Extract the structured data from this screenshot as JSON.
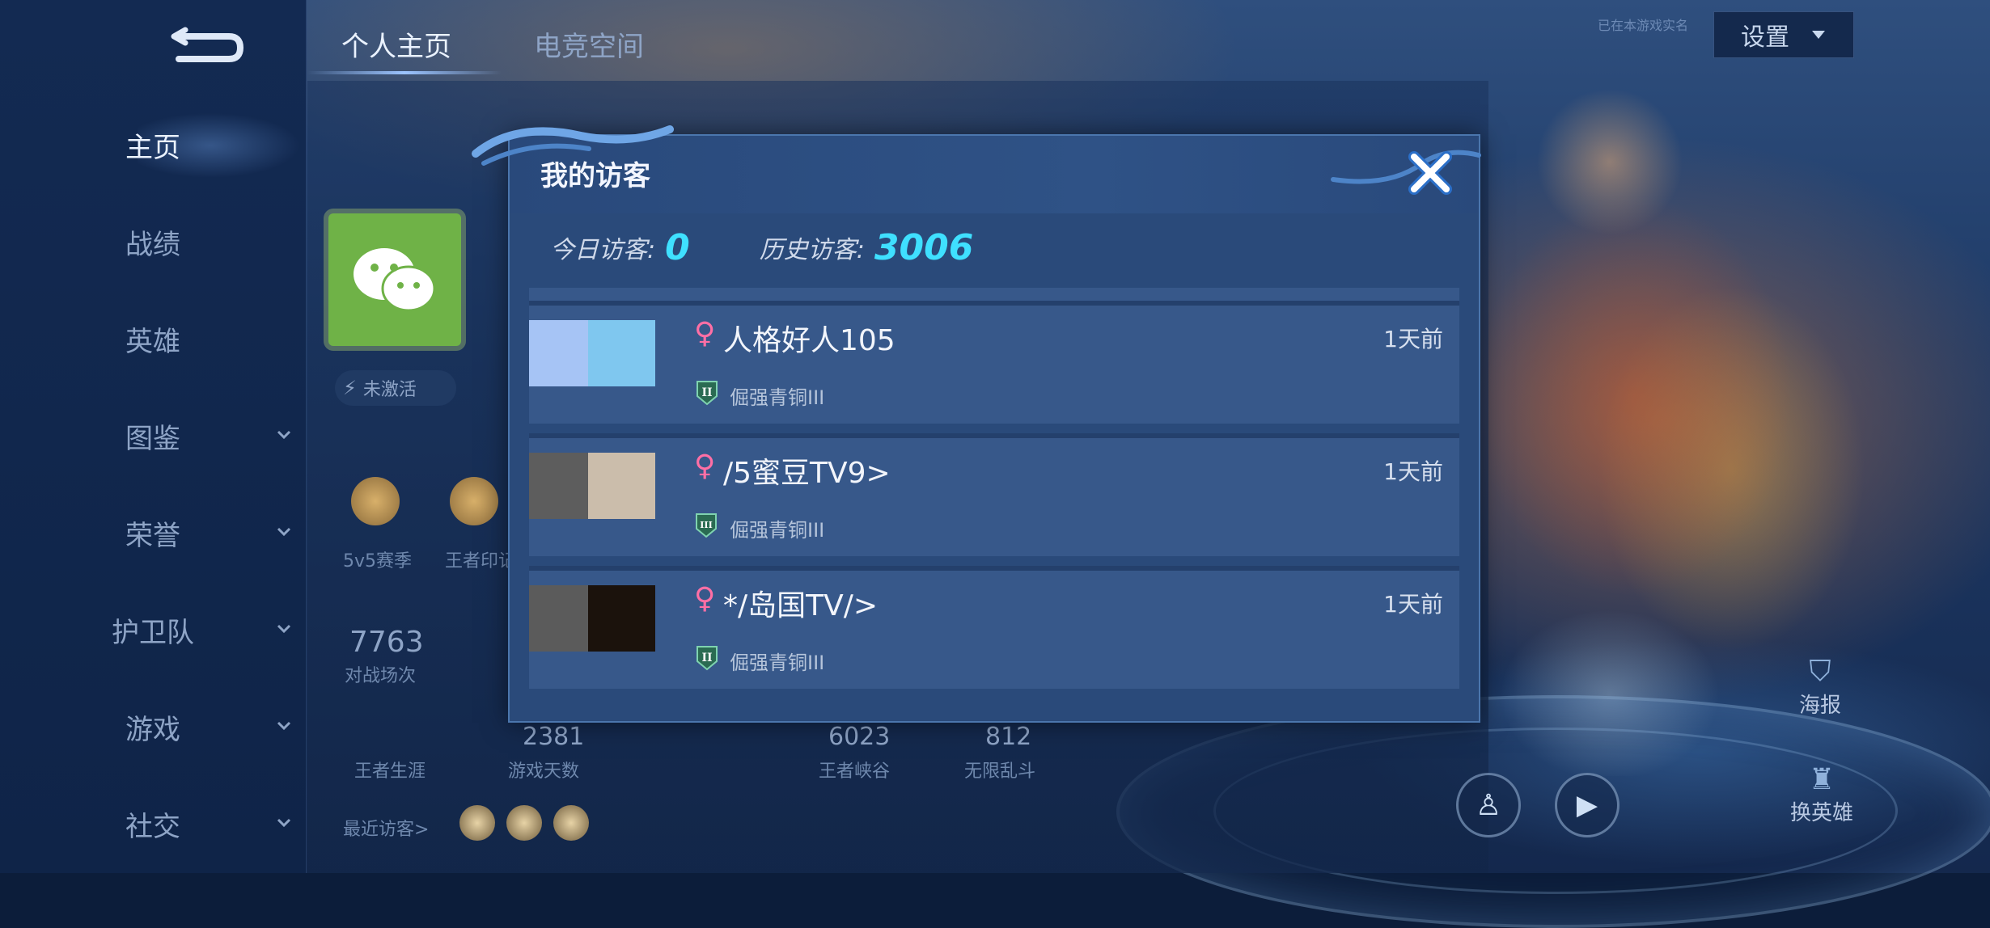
{
  "sidebar": {
    "items": [
      {
        "label": "主页",
        "active": true
      },
      {
        "label": "战绩"
      },
      {
        "label": "英雄"
      },
      {
        "label": "图鉴",
        "expandable": true
      },
      {
        "label": "荣誉",
        "expandable": true
      },
      {
        "label": "护卫队",
        "expandable": true
      },
      {
        "label": "游戏",
        "expandable": true
      },
      {
        "label": "社交",
        "expandable": true
      }
    ]
  },
  "tabs": [
    {
      "label": "个人主页",
      "active": true
    },
    {
      "label": "电竞空间"
    }
  ],
  "header": {
    "small_note": "已在本游戏实名",
    "settings_label": "设置"
  },
  "profile": {
    "inactive_label": "未激活",
    "badges": [
      {
        "label": "5v5赛季"
      },
      {
        "label": "王者印记"
      }
    ],
    "stats": [
      {
        "value": "7763",
        "label": "对战场次"
      },
      {
        "value": "2381",
        "label": "游戏天数"
      },
      {
        "value": "6023",
        "label": "王者峡谷"
      },
      {
        "value": "812",
        "label": "无限乱斗"
      }
    ],
    "career_label": "王者生涯",
    "recent_visitors_label": "最近访客>"
  },
  "right_panel": {
    "poster_label": "海报",
    "change_hero_label": "换英雄"
  },
  "modal": {
    "title": "我的访客",
    "today_label": "今日访客:",
    "today_value": "0",
    "history_label": "历史访客:",
    "history_value": "3006",
    "visitors": [
      {
        "name": "人格好人105",
        "gender_symbol": "♀",
        "time": "1天前",
        "rank": "倔强青铜III",
        "rank_numeral": "II",
        "avatar_colors": [
          "#a6c4f5",
          "#7fc7ef"
        ]
      },
      {
        "name": "/5蜜豆TV9>",
        "gender_symbol": "♀",
        "time": "1天前",
        "rank": "倔强青铜III",
        "rank_numeral": "III",
        "avatar_colors": [
          "#5d5d5d",
          "#cbbdab"
        ]
      },
      {
        "name": "*/岛国TV/>",
        "gender_symbol": "♀",
        "time": "1天前",
        "rank": "倔强青铜III",
        "rank_numeral": "II",
        "avatar_colors": [
          "#5b5b5b",
          "#1b120c"
        ]
      }
    ]
  },
  "colors": {
    "accent_cyan": "#3fe0ff",
    "female_pink": "#ff6fa5",
    "modal_bg": "#2a4a7a",
    "row_bg": "#37588a"
  }
}
